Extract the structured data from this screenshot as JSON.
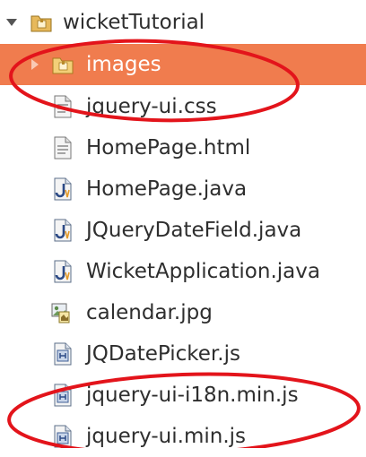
{
  "tree": {
    "root": {
      "label": "wicketTutorial",
      "icon": "package-folder-icon",
      "expanded": true
    },
    "items": [
      {
        "label": "images",
        "icon": "package-folder-icon",
        "selected": true,
        "expandable": true
      },
      {
        "label": "jquery-ui.css",
        "icon": "text-file-icon"
      },
      {
        "label": "HomePage.html",
        "icon": "text-file-icon"
      },
      {
        "label": "HomePage.java",
        "icon": "java-file-icon"
      },
      {
        "label": "JQueryDateField.java",
        "icon": "java-file-icon"
      },
      {
        "label": "WicketApplication.java",
        "icon": "java-file-icon"
      },
      {
        "label": "calendar.jpg",
        "icon": "image-file-icon"
      },
      {
        "label": "JQDatePicker.js",
        "icon": "js-file-icon"
      },
      {
        "label": "jquery-ui-i18n.min.js",
        "icon": "js-file-icon"
      },
      {
        "label": "jquery-ui.min.js",
        "icon": "js-file-icon"
      }
    ]
  },
  "colors": {
    "selection": "#f07c4e",
    "annotation": "#e3141b",
    "folder": "#e7b95b"
  }
}
